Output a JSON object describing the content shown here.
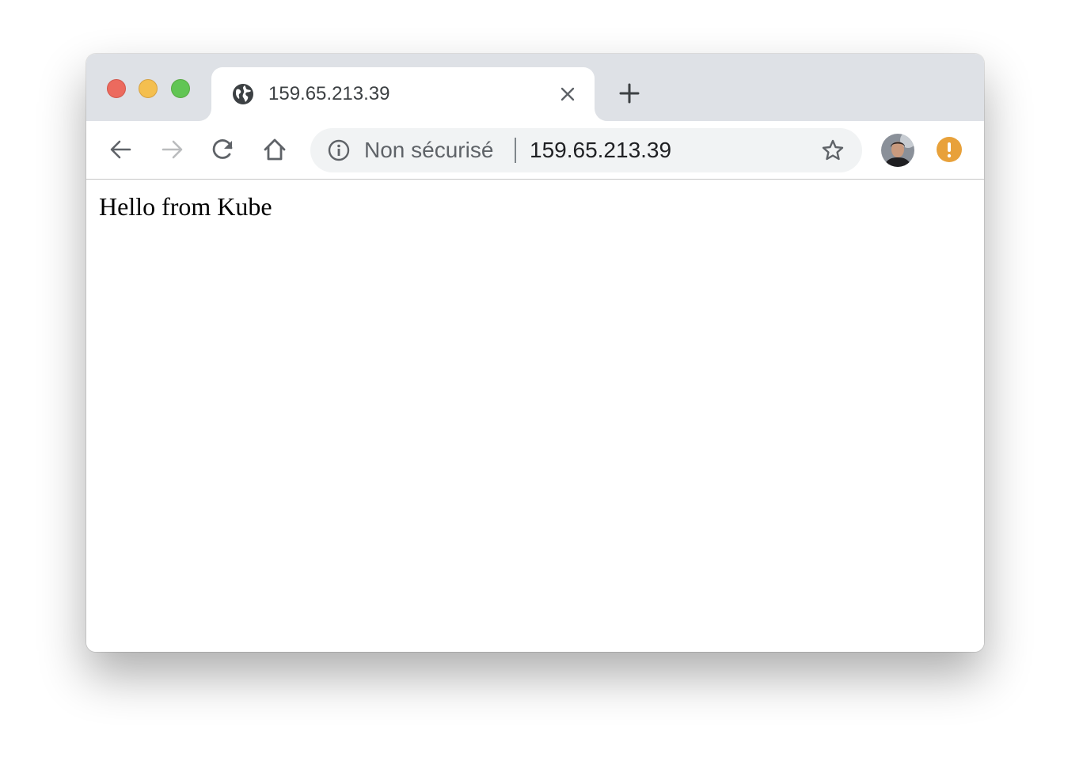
{
  "window": {
    "traffic_lights": {
      "close_color": "#ec6a5e",
      "minimize_color": "#f4bf4f",
      "zoom_color": "#61c554"
    }
  },
  "tab": {
    "title": "159.65.213.39",
    "favicon": "globe-icon",
    "close_icon": "close-icon"
  },
  "new_tab": {
    "icon": "plus-icon"
  },
  "toolbar": {
    "back_icon": "arrow-left-icon",
    "forward_icon": "arrow-right-icon",
    "reload_icon": "reload-icon",
    "home_icon": "home-icon",
    "omnibox": {
      "info_icon": "info-icon",
      "security_label": "Non sécurisé",
      "url": "159.65.213.39",
      "bookmark_icon": "star-icon"
    },
    "profile_avatar": "avatar",
    "alert_icon": "exclamation-icon",
    "alert_color": "#e8a13a"
  },
  "page": {
    "text": "Hello from Kube"
  }
}
